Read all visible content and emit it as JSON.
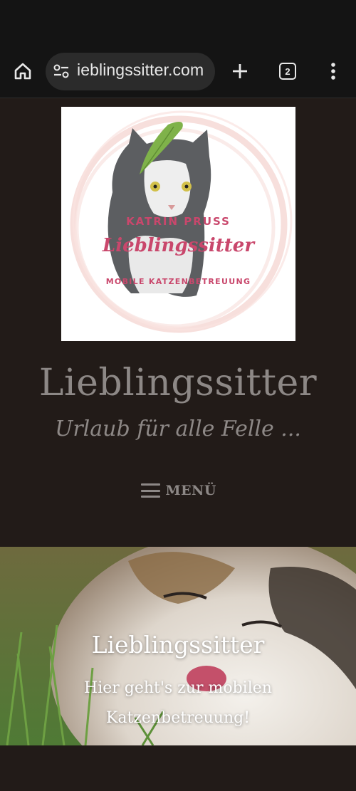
{
  "browser": {
    "url": "ieblingssitter.com",
    "tab_count": "2",
    "icons": [
      "home-icon",
      "site-settings-icon",
      "new-tab-icon",
      "tab-switcher-icon",
      "more-vert-icon"
    ]
  },
  "logo": {
    "name_line": "KATRIN PRUSS",
    "brand": "Lieblingssitter",
    "subline": "MOBILE KATZENBETREUUNG"
  },
  "site": {
    "title": "Lieblingssitter",
    "tagline": "Urlaub für alle Felle ..."
  },
  "nav": {
    "menu_label": "MENÜ"
  },
  "hero": {
    "title": "Lieblingssitter",
    "text": "Hier geht's zur mobilen Katzenbetreuung!"
  },
  "colors": {
    "page_bg": "#221b18",
    "text_muted": "#8d8886",
    "logo_accent": "#c9476c",
    "toolbar_bg": "#141414"
  }
}
